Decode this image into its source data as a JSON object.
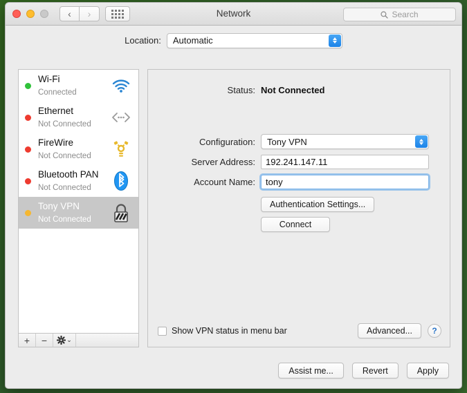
{
  "window": {
    "title": "Network",
    "traffic_lights": [
      "close",
      "minimize",
      "zoom"
    ],
    "back_glyph": "‹",
    "forward_glyph": "›",
    "grid_icon": "apps-grid-icon"
  },
  "search": {
    "placeholder": "Search",
    "value": ""
  },
  "location": {
    "label": "Location:",
    "selected": "Automatic"
  },
  "sidebar": {
    "items": [
      {
        "name": "Wi-Fi",
        "status": "Connected",
        "dot": "#30c23a",
        "icon": "wifi-icon",
        "selected": false
      },
      {
        "name": "Ethernet",
        "status": "Not Connected",
        "dot": "#ee3b2f",
        "icon": "ethernet-icon",
        "selected": false
      },
      {
        "name": "FireWire",
        "status": "Not Connected",
        "dot": "#ee3b2f",
        "icon": "firewire-icon",
        "selected": false
      },
      {
        "name": "Bluetooth PAN",
        "status": "Not Connected",
        "dot": "#ee3b2f",
        "icon": "bluetooth-icon",
        "selected": false
      },
      {
        "name": "Tony VPN",
        "status": "Not Connected",
        "dot": "#f5b731",
        "icon": "vpn-lock-icon",
        "selected": true
      }
    ],
    "toolbar": {
      "add": "+",
      "remove": "−",
      "actions": "gear-icon",
      "chevron": "⌄"
    }
  },
  "detail": {
    "status_label": "Status:",
    "status_value": "Not Connected",
    "configuration_label": "Configuration:",
    "configuration_value": "Tony VPN",
    "server_address_label": "Server Address:",
    "server_address_value": "192.241.147.11",
    "account_name_label": "Account Name:",
    "account_name_value": "tony",
    "auth_button": "Authentication Settings...",
    "connect_button": "Connect",
    "show_status_checkbox": "Show VPN status in menu bar",
    "show_status_checked": false,
    "advanced_button": "Advanced...",
    "help_button": "?"
  },
  "footer": {
    "assist": "Assist me...",
    "revert": "Revert",
    "apply": "Apply"
  },
  "colors": {
    "accent_blue": "#1c83e8",
    "focus_ring": "#7fb4e8",
    "connected_green": "#30c23a",
    "disconnected_red": "#ee3b2f",
    "pending_orange": "#f5b731"
  }
}
